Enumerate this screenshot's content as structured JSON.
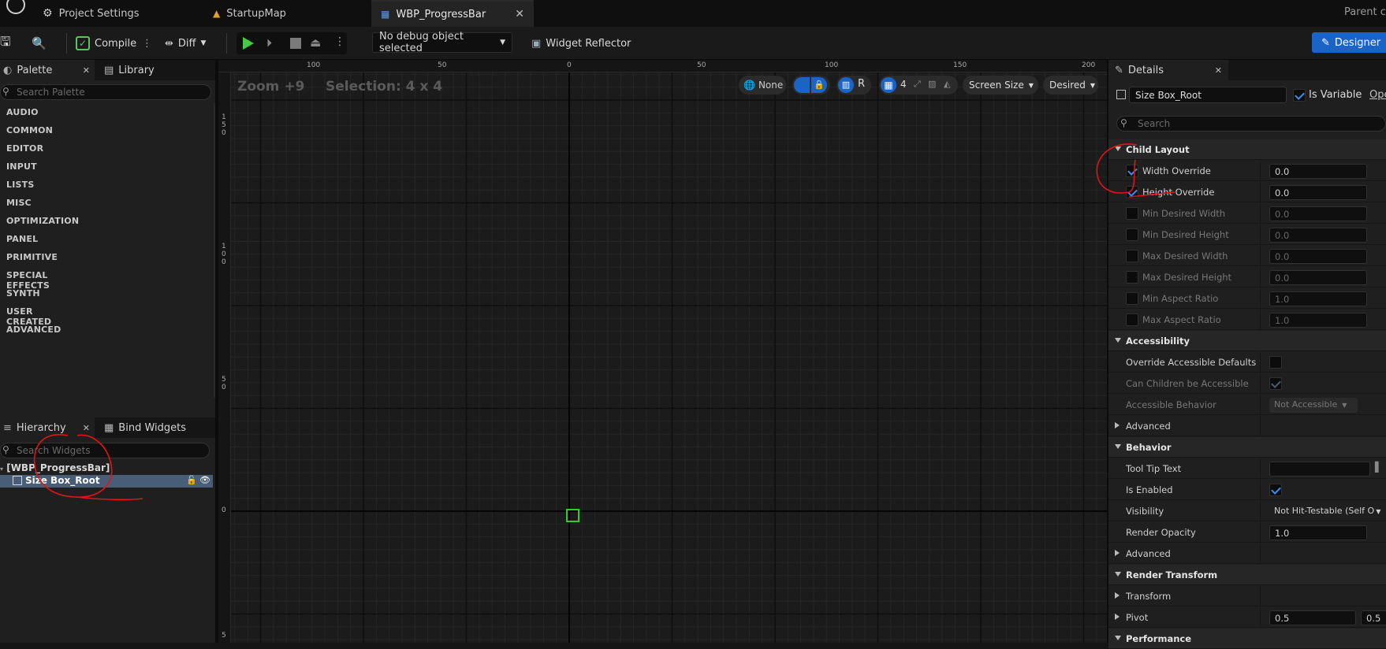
{
  "tabs": [
    {
      "label": "Project Settings"
    },
    {
      "label": "StartupMap"
    },
    {
      "label": "WBP_ProgressBar"
    }
  ],
  "top_right_text": "Parent cl",
  "toolbar": {
    "compile": "Compile",
    "diff": "Diff",
    "debug_select": "No debug object selected",
    "widget_reflector": "Widget Reflector",
    "designer": "Designer"
  },
  "palette": {
    "tab_label": "Palette",
    "library_label": "Library",
    "search_placeholder": "Search Palette",
    "categories": [
      "AUDIO",
      "COMMON",
      "EDITOR",
      "INPUT",
      "LISTS",
      "MISC",
      "OPTIMIZATION",
      "PANEL",
      "PRIMITIVE",
      "SPECIAL EFFECTS",
      "SYNTH",
      "USER CREATED",
      "ADVANCED"
    ]
  },
  "hierarchy": {
    "tab_label": "Hierarchy",
    "bind_label": "Bind Widgets",
    "search_placeholder": "Search Widgets",
    "root": "[WBP_ProgressBar]",
    "child": "Size Box_Root"
  },
  "canvas": {
    "zoom": "Zoom +9",
    "selection": "Selection: 4 x 4",
    "ruler_top": [
      "100",
      "50",
      "0",
      "50",
      "100",
      "150",
      "200"
    ],
    "ruler_left": [
      [
        "1",
        "5",
        "0"
      ],
      [
        "1",
        "0",
        "0"
      ],
      [
        "5",
        "0"
      ],
      [
        "0"
      ],
      [
        "5"
      ]
    ],
    "none_label": "None",
    "r_label": "R",
    "grid_snap": "4",
    "screen_size": "Screen Size",
    "desired": "Desired"
  },
  "details": {
    "tab_label": "Details",
    "name": "Size Box_Root",
    "is_variable": "Is Variable",
    "open": "Ope",
    "search_placeholder": "Search",
    "sections": {
      "child_layout": "Child Layout",
      "accessibility": "Accessibility",
      "advanced1": "Advanced",
      "behavior": "Behavior",
      "advanced2": "Advanced",
      "render_transform": "Render Transform",
      "transform": "Transform",
      "pivot": "Pivot",
      "performance": "Performance"
    },
    "child_layout_rows": [
      {
        "label": "Width Override",
        "value": "0.0"
      },
      {
        "label": "Height Override",
        "value": "0.0"
      },
      {
        "label": "Min Desired Width",
        "value": "0.0"
      },
      {
        "label": "Min Desired Height",
        "value": "0.0"
      },
      {
        "label": "Max Desired Width",
        "value": "0.0"
      },
      {
        "label": "Max Desired Height",
        "value": "0.0"
      },
      {
        "label": "Min Aspect Ratio",
        "value": "1.0"
      },
      {
        "label": "Max Aspect Ratio",
        "value": "1.0"
      }
    ],
    "accessibility_rows": {
      "override": "Override Accessible Defaults",
      "children": "Can Children be Accessible",
      "behavior": "Accessible Behavior",
      "behavior_value": "Not Accessible"
    },
    "behavior_rows": {
      "tooltip": "Tool Tip Text",
      "enabled": "Is Enabled",
      "visibility": "Visibility",
      "visibility_value": "Not Hit-Testable (Self O",
      "opacity": "Render Opacity",
      "opacity_value": "1.0"
    },
    "pivot_x": "0.5",
    "pivot_y": "0.5"
  },
  "colors": {
    "accent": "#1a64c8",
    "selection_green": "#2ecc2e",
    "annotation_red": "#e01515"
  }
}
